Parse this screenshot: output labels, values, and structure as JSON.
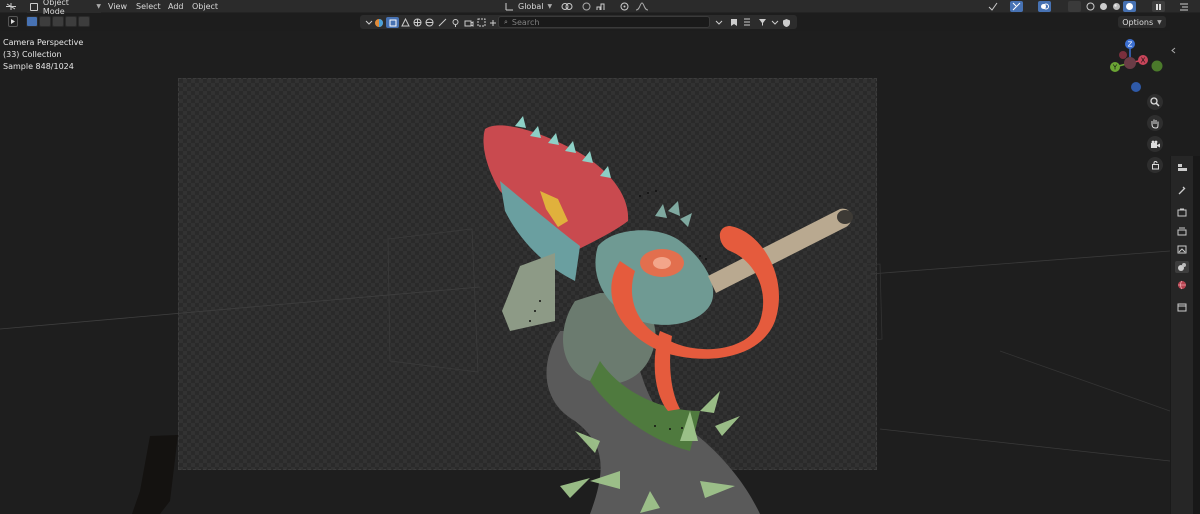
{
  "header": {
    "mode_label": "Object Mode",
    "menu": [
      "View",
      "Select",
      "Add",
      "Object"
    ],
    "transform_orientation": "Global"
  },
  "toolbar": {
    "search_placeholder": "Search",
    "options_label": "Options"
  },
  "viewport": {
    "camera_label": "Camera Perspective",
    "collection_label": "(33) Collection",
    "sample_label": "Sample 848/1024"
  },
  "gizmo": {
    "z_label": "Z",
    "y_label": "Y",
    "x_label": "X"
  },
  "colors": {
    "accent": "#4772b3",
    "header_bg": "#2b2b2b",
    "viewport_bg": "#1e1e1e",
    "axis_x": "#c8455a",
    "axis_y": "#6ba534",
    "axis_z": "#3b6fd1"
  },
  "icons": {
    "editor_type": "editor-type-icon",
    "select_box": "select-box-icon",
    "zoom": "magnifier-icon",
    "pan": "hand-icon",
    "camera": "camera-icon",
    "lock": "lock-icon"
  }
}
